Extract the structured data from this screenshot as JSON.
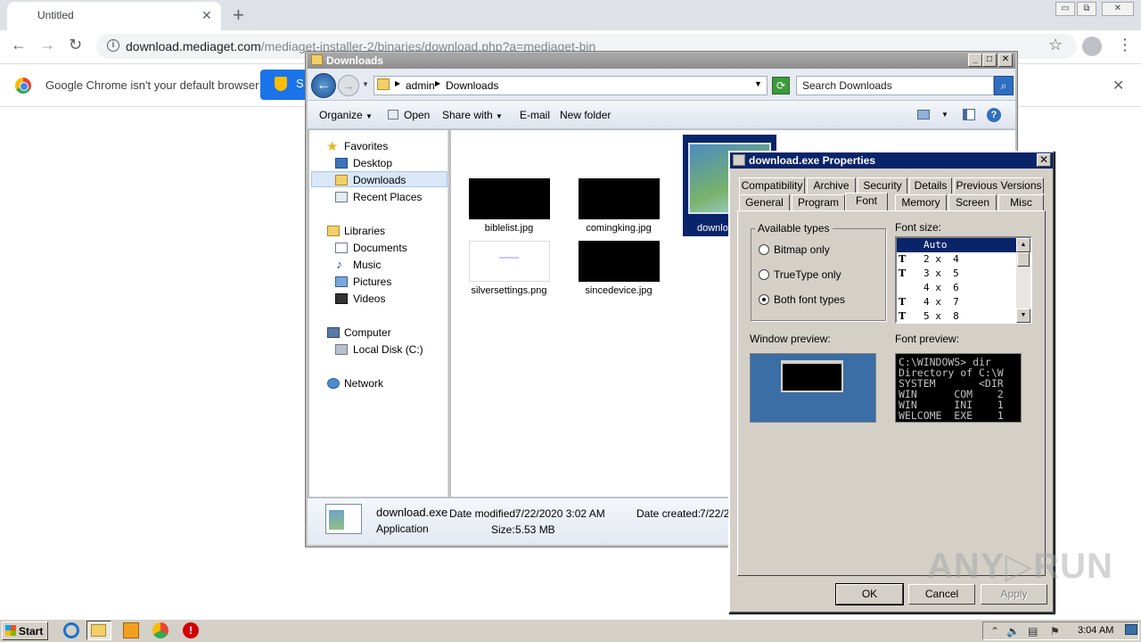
{
  "chrome": {
    "tab_title": "Untitled",
    "tab_close": "✕",
    "new_tab": "+",
    "window_controls": [
      "▭",
      "⧉",
      "✕"
    ],
    "nav": {
      "back": "←",
      "forward": "→",
      "reload": "↻"
    },
    "url_host": "download.mediaget.com",
    "url_path": "/mediaget-installer-2/binaries/download.php?a=mediaget-bin",
    "info_icon": "i",
    "star": "☆",
    "menu": "⋮",
    "infobar_text": "Google Chrome isn't your default browser",
    "infobar_button": "S",
    "infobar_close": "✕"
  },
  "explorer": {
    "title": "Downloads",
    "controls": [
      "_",
      "□",
      "✕"
    ],
    "breadcrumb": [
      "admin",
      "Downloads"
    ],
    "search_placeholder": "Search Downloads",
    "back": "←",
    "forward": "→",
    "commands": {
      "organize": "Organize",
      "open": "Open",
      "share": "Share with",
      "email": "E-mail",
      "new_folder": "New folder"
    },
    "nav": {
      "favorites": "Favorites",
      "desktop": "Desktop",
      "downloads": "Downloads",
      "recent": "Recent Places",
      "libraries": "Libraries",
      "documents": "Documents",
      "music": "Music",
      "pictures": "Pictures",
      "videos": "Videos",
      "computer": "Computer",
      "local_disk": "Local Disk (C:)",
      "network": "Network"
    },
    "files": [
      {
        "name": "biblelist.jpg"
      },
      {
        "name": "comingking.jpg"
      },
      {
        "name": "silversettings.png"
      },
      {
        "name": "sincedevice.jpg"
      }
    ],
    "selected_file_label": "downlo",
    "details": {
      "name": "download.exe",
      "type": "Application",
      "modified_label": "Date modified:",
      "modified_value": "7/22/2020 3:02 AM",
      "size_label": "Size:",
      "size_value": "5.53 MB",
      "created_label": "Date created:",
      "created_value": "7/22/2"
    }
  },
  "props": {
    "title": "download.exe Properties",
    "close": "✕",
    "tabs_row1": [
      "Compatibility",
      "Archive",
      "Security",
      "Details",
      "Previous Versions"
    ],
    "tabs_row2": [
      "General",
      "Program",
      "Font",
      "Memory",
      "Screen",
      "Misc"
    ],
    "active_tab": "Font",
    "available_types_label": "Available types",
    "radio_bitmap": "Bitmap only",
    "radio_truetype": "TrueType only",
    "radio_both": "Both font types",
    "selected_type": "Both font types",
    "font_size_label": "Font size:",
    "font_sizes": [
      {
        "tt": "",
        "text": "Auto"
      },
      {
        "tt": "T",
        "text": "2 x  4"
      },
      {
        "tt": "T",
        "text": "3 x  5"
      },
      {
        "tt": "",
        "text": "4 x  6"
      },
      {
        "tt": "T",
        "text": "4 x  7"
      },
      {
        "tt": "T",
        "text": "5 x  8"
      }
    ],
    "window_preview_label": "Window preview:",
    "font_preview_label": "Font preview:",
    "font_preview_lines": [
      "C:\\WINDOWS> dir",
      "Directory of C:\\W",
      "SYSTEM       <DIR",
      "WIN      COM    2",
      "WIN      INI    1",
      "WELCOME  EXE    1"
    ],
    "buttons": {
      "ok": "OK",
      "cancel": "Cancel",
      "apply": "Apply"
    }
  },
  "watermark": "ANY▷RUN",
  "taskbar": {
    "start": "Start",
    "time": "3:04 AM"
  }
}
